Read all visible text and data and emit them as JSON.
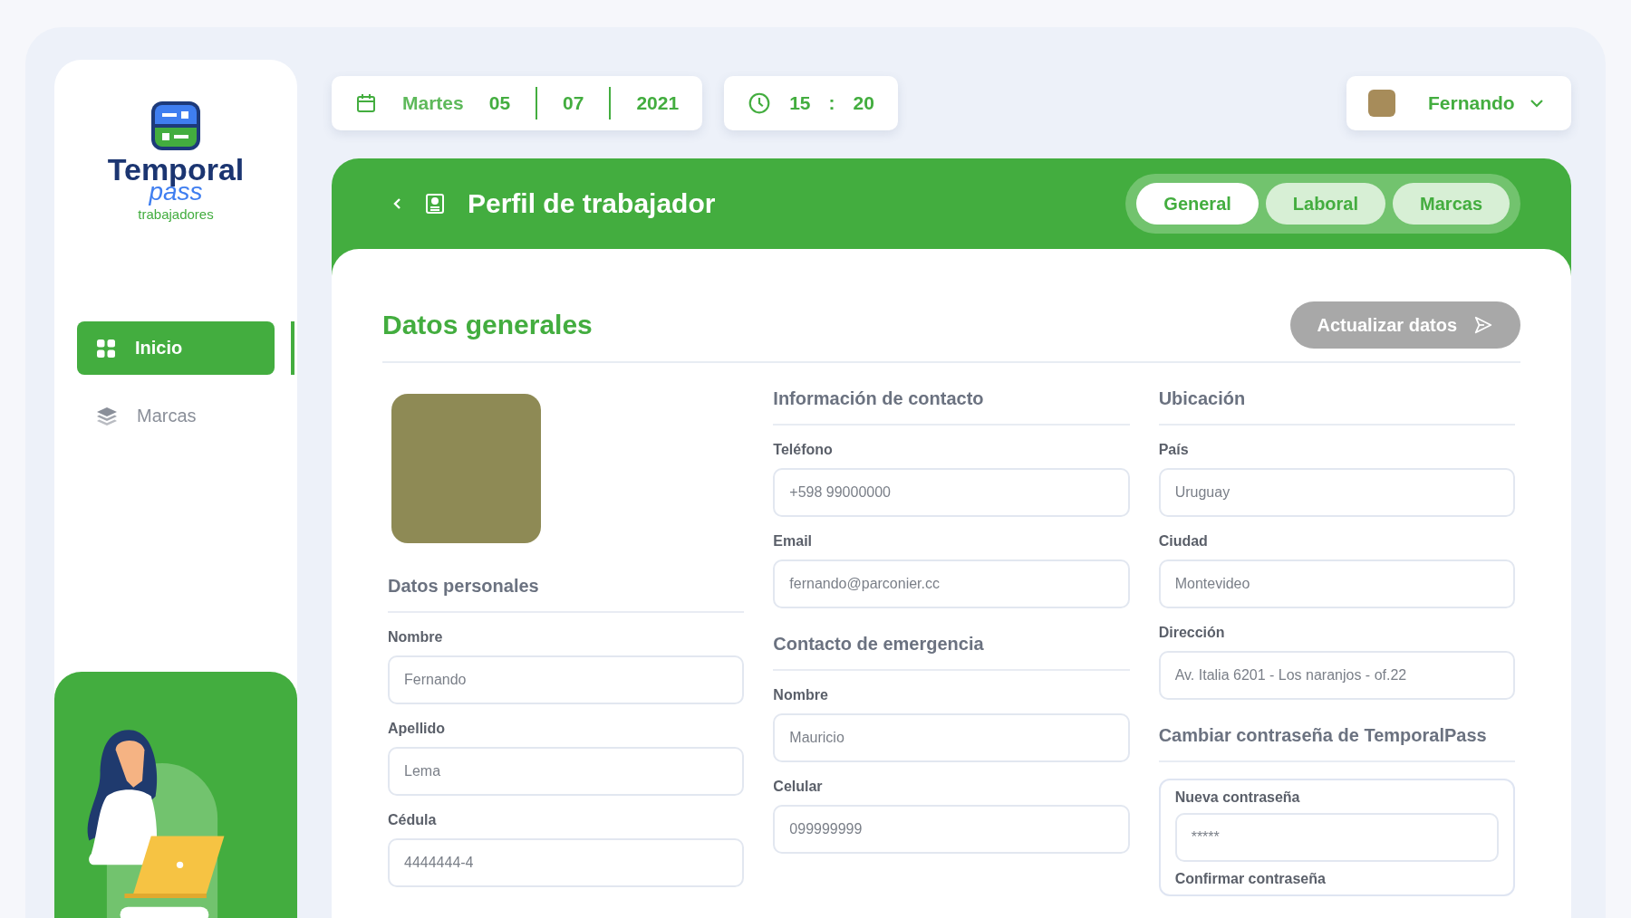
{
  "sidebar": {
    "logo": {
      "title": "Temporal",
      "subtitle": "pass",
      "tagline": "trabajadores"
    },
    "items": [
      {
        "label": "Inicio",
        "kind": "grid",
        "selected": true
      },
      {
        "label": "Marcas",
        "kind": "layers",
        "selected": false
      }
    ]
  },
  "date": {
    "weekday": "Martes",
    "day": "05",
    "month": "07",
    "year": "2021"
  },
  "time": {
    "hours": "15",
    "separator": ":",
    "minutes": "20"
  },
  "user": {
    "name": "Fernando"
  },
  "header": {
    "title": "Perfil de trabajador",
    "tabs": [
      {
        "label": "General",
        "selected": true
      },
      {
        "label": "Laboral",
        "selected": false
      },
      {
        "label": "Marcas",
        "selected": false
      }
    ]
  },
  "section": {
    "title": "Datos generales",
    "button": "Actualizar datos"
  },
  "columns": [
    {
      "groups": [
        {
          "kind": "plain",
          "heading": "Datos personales",
          "fields": [
            {
              "label": "Nombre",
              "value": "Fernando"
            },
            {
              "label": "Apellido",
              "value": "Lema"
            },
            {
              "label": "Cédula",
              "value": "4444444-4"
            }
          ]
        }
      ]
    },
    {
      "groups": [
        {
          "kind": "plain",
          "heading": "Información de contacto",
          "fields": [
            {
              "label": "Teléfono",
              "value": "+598 99000000"
            },
            {
              "label": "Email",
              "value": "fernando@parconier.cc"
            }
          ]
        },
        {
          "kind": "plain",
          "heading": "Contacto de emergencia",
          "fields": [
            {
              "label": "Nombre",
              "value": "Mauricio"
            },
            {
              "label": "Celular",
              "value": "099999999"
            }
          ]
        }
      ]
    },
    {
      "groups": [
        {
          "kind": "plain",
          "heading": "Ubicación",
          "fields": [
            {
              "label": "País",
              "value": "Uruguay"
            },
            {
              "label": "Ciudad",
              "value": "Montevideo"
            },
            {
              "label": "Dirección",
              "value": "Av. Italia 6201 - Los naranjos - of.22"
            }
          ]
        },
        {
          "kind": "boxed",
          "heading": "Cambiar contraseña de TemporalPass",
          "fields": [
            {
              "label": "Nueva contraseña",
              "value": "*****"
            },
            {
              "label": "Confirmar contraseña"
            }
          ]
        }
      ]
    }
  ]
}
